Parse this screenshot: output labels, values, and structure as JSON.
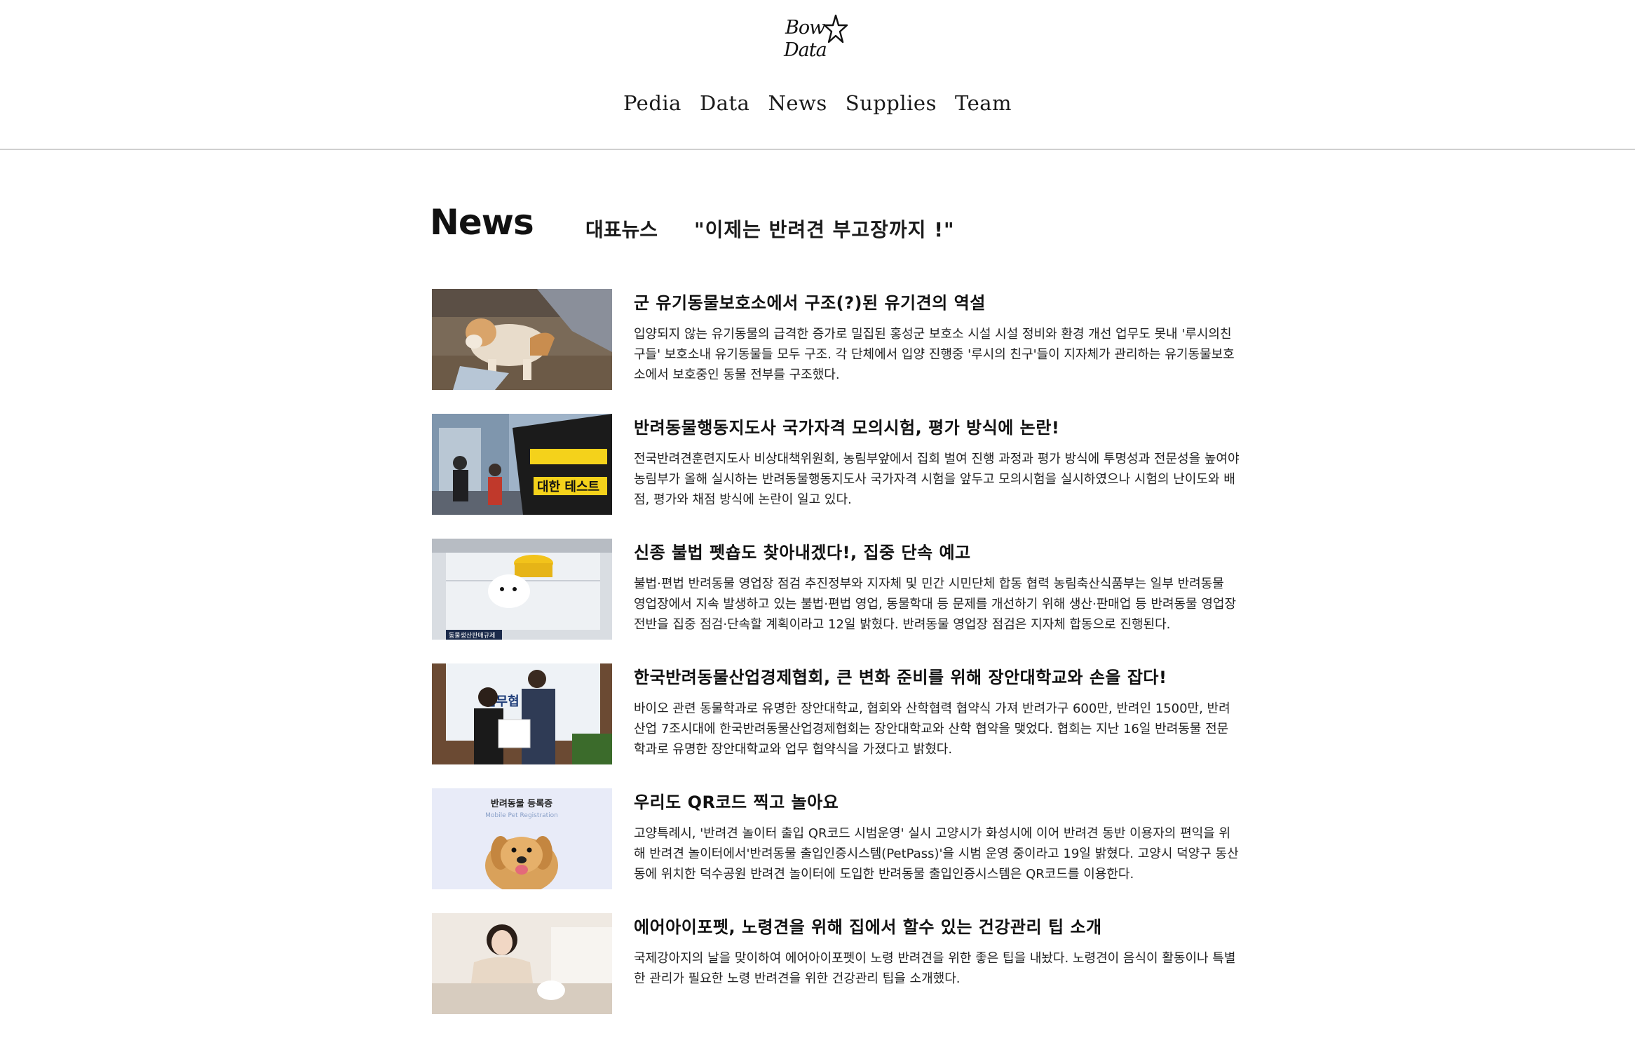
{
  "header": {
    "logo_line1": "Bow",
    "logo_line2": "Data",
    "nav": [
      "Pedia",
      "Data",
      "News",
      "Supplies",
      "Team"
    ]
  },
  "news": {
    "section_title": "News",
    "featured_label": "대표뉴스",
    "featured_headline": "\"이제는 반려견 부고장까지 !\"",
    "articles": [
      {
        "title": "군 유기동물보호소에서 구조(?)된 유기견의 역설",
        "summary": "입양되지 않는 유기동물의 급격한 증가로 밀집된 홍성군 보호소 시설 시설 정비와 환경 개선 업무도 못내 '루시의친구들' 보호소내 유기동물들 모두 구조. 각 단체에서 입양 진행중 '루시의 친구'들이 지자체가 관리하는 유기동물보호소에서 보호중인 동물 전부를 구조했다."
      },
      {
        "title": "반려동물행동지도사 국가자격 모의시험, 평가 방식에 논란!",
        "summary": "전국반려견훈련지도사 비상대책위원회, 농림부앞에서 집회 벌여 진행 과정과 평가 방식에 투명성과 전문성을 높여야 농림부가 올해 실시하는 반려동물행동지도사 국가자격 시험을 앞두고 모의시험을 실시하였으나 시험의 난이도와 배점, 평가와 채점 방식에 논란이 일고 있다."
      },
      {
        "title": "신종 불법 펫숍도 찾아내겠다!, 집중 단속 예고",
        "summary": "불법·편법 반려동물 영업장 점검 추진정부와 지자체 및 민간 시민단체 합동 협력 농림축산식품부는 일부 반려동물 영업장에서 지속 발생하고 있는 불법·편법 영업, 동물학대 등 문제를 개선하기 위해 생산·판매업 등 반려동물 영업장 전반을 집중 점검·단속할 계획이라고 12일 밝혔다. 반려동물 영업장 점검은 지자체 합동으로 진행된다."
      },
      {
        "title": "한국반려동물산업경제협회, 큰 변화 준비를 위해 장안대학교와 손을 잡다!",
        "summary": "바이오 관련 동물학과로 유명한 장안대학교, 협회와 산학협력 협약식 가져 반려가구 600만, 반려인 1500만, 반려산업 7조시대에 한국반려동물산업경제협회는 장안대학교와 산학 협약을 맺었다. 협회는 지난 16일 반려동물 전문학과로 유명한 장안대학교와 업무 협약식을 가졌다고 밝혔다."
      },
      {
        "title": "우리도 QR코드 찍고 놀아요",
        "summary": "고양특례시, '반려견 놀이터 출입 QR코드 시범운영' 실시 고양시가 화성시에 이어 반려견 동반 이용자의 편익을 위해 반려견 놀이터에서'반려동물 출입인증시스템(PetPass)'을 시범 운영 중이라고 19일 밝혔다. 고양시 덕양구 동산동에 위치한 덕수공원 반려견 놀이터에 도입한 반려동물 출입인증시스템은 QR코드를 이용한다."
      },
      {
        "title": "에어아이포펫, 노령견을 위해 집에서 할수 있는 건강관리 팁 소개",
        "summary": "국제강아지의 날을 맞이하여 에어아이포펫이 노령 반려견을 위한 좋은 팁을 내놨다. 노령견이 음식이 활동이나 특별한 관리가 필요한 노령 반려견을 위한 건강관리 팁을 소개했다."
      }
    ],
    "thumb_texts": {
      "protest_sign": "대한 테스트",
      "store_sign": "동물생산판매규제",
      "mou_banner": "업무협",
      "registration_title": "반려동물 등록증",
      "registration_sub": "Mobile Pet Registration"
    }
  }
}
